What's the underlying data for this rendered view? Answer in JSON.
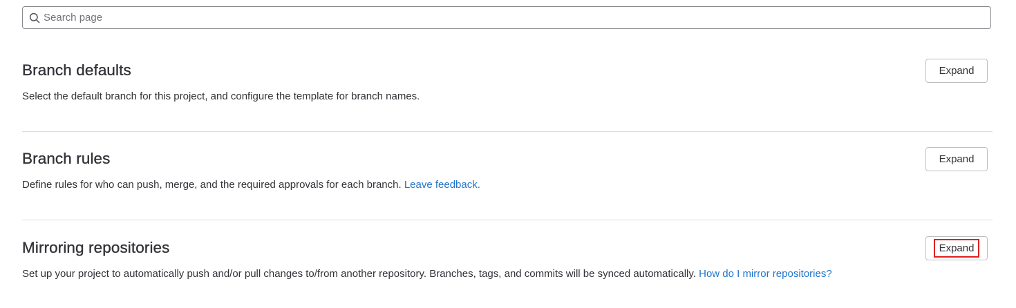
{
  "search": {
    "placeholder": "Search page"
  },
  "sections": [
    {
      "title": "Branch defaults",
      "description": "Select the default branch for this project, and configure the template for branch names.",
      "link": "",
      "expand_label": "Expand"
    },
    {
      "title": "Branch rules",
      "description": "Define rules for who can push, merge, and the required approvals for each branch. ",
      "link": "Leave feedback.",
      "expand_label": "Expand"
    },
    {
      "title": "Mirroring repositories",
      "description": "Set up your project to automatically push and/or pull changes to/from another repository. Branches, tags, and commits will be synced automatically. ",
      "link": "How do I mirror repositories?",
      "expand_label": "Expand"
    }
  ],
  "colors": {
    "link": "#1f75cb",
    "highlight": "#e0201d",
    "text": "#333238"
  },
  "icons": {
    "search": "search-icon"
  }
}
